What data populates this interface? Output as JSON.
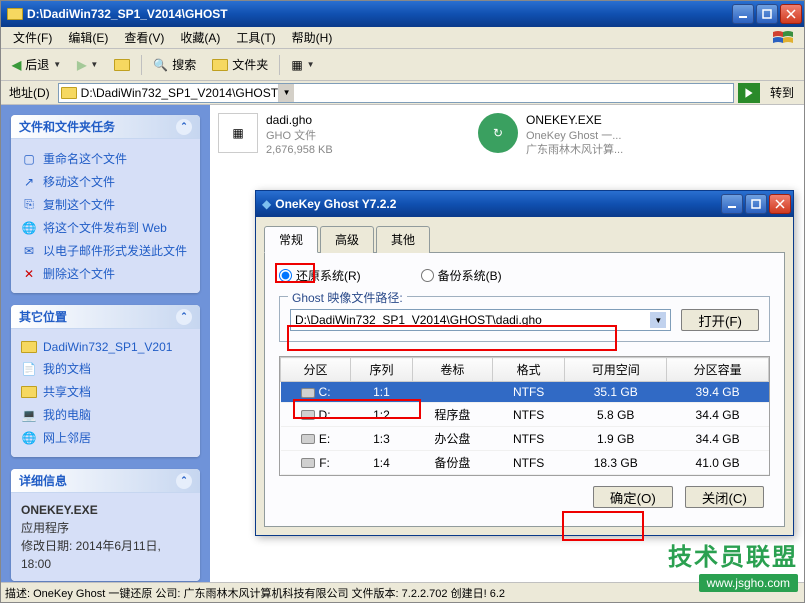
{
  "window": {
    "title": "D:\\DadiWin732_SP1_V2014\\GHOST"
  },
  "menu": {
    "file": "文件(F)",
    "edit": "编辑(E)",
    "view": "查看(V)",
    "favorites": "收藏(A)",
    "tools": "工具(T)",
    "help": "帮助(H)"
  },
  "toolbar": {
    "back": "后退",
    "search": "搜索",
    "folders": "文件夹"
  },
  "addressbar": {
    "label": "地址(D)",
    "path": "D:\\DadiWin732_SP1_V2014\\GHOST",
    "goto": "转到"
  },
  "sidebar": {
    "tasks_title": "文件和文件夹任务",
    "tasks": [
      "重命名这个文件",
      "移动这个文件",
      "复制这个文件",
      "将这个文件发布到 Web",
      "以电子邮件形式发送此文件",
      "删除这个文件"
    ],
    "places_title": "其它位置",
    "places": [
      "DadiWin732_SP1_V201",
      "我的文档",
      "共享文档",
      "我的电脑",
      "网上邻居"
    ],
    "details_title": "详细信息",
    "details": {
      "name": "ONEKEY.EXE",
      "type": "应用程序",
      "date_label": "修改日期: 2014年6月11日, 18:00"
    }
  },
  "files": [
    {
      "name": "dadi.gho",
      "type": "GHO 文件",
      "size": "2,676,958 KB"
    },
    {
      "name": "ONEKEY.EXE",
      "type": "OneKey Ghost 一...",
      "meta": "广东雨林木风计算..."
    }
  ],
  "dialog": {
    "title": "OneKey Ghost Y7.2.2",
    "tabs": {
      "general": "常规",
      "advanced": "高级",
      "other": "其他"
    },
    "radio_restore": "还原系统(R)",
    "radio_backup": "备份系统(B)",
    "fieldset_label": "Ghost 映像文件路径:",
    "path": "D:\\DadiWin732_SP1_V2014\\GHOST\\dadi.gho",
    "open_btn": "打开(F)",
    "columns": {
      "part": "分区",
      "seq": "序列",
      "label": "卷标",
      "fmt": "格式",
      "avail": "可用空间",
      "cap": "分区容量"
    },
    "rows": [
      {
        "part": "C:",
        "seq": "1:1",
        "label": "",
        "fmt": "NTFS",
        "avail": "35.1 GB",
        "cap": "39.4 GB"
      },
      {
        "part": "D:",
        "seq": "1:2",
        "label": "程序盘",
        "fmt": "NTFS",
        "avail": "5.8 GB",
        "cap": "34.4 GB"
      },
      {
        "part": "E:",
        "seq": "1:3",
        "label": "办公盘",
        "fmt": "NTFS",
        "avail": "1.9 GB",
        "cap": "34.4 GB"
      },
      {
        "part": "F:",
        "seq": "1:4",
        "label": "备份盘",
        "fmt": "NTFS",
        "avail": "18.3 GB",
        "cap": "41.0 GB"
      }
    ],
    "ok": "确定(O)",
    "close": "关闭(C)"
  },
  "status": "描述: OneKey Ghost 一键还原 公司: 广东雨林木风计算机科技有限公司 文件版本: 7.2.2.702 创建日! 6.2",
  "watermark": {
    "cn": "技术员联盟",
    "url": "www.jsgho.com"
  }
}
